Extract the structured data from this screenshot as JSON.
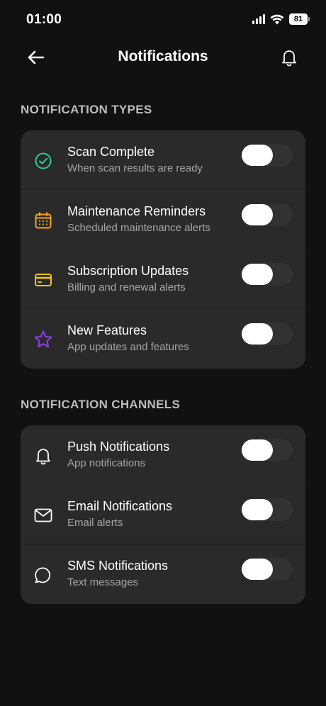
{
  "status_bar": {
    "time": "01:00",
    "battery": "81"
  },
  "header": {
    "title": "Notifications",
    "back_icon": "arrow-left-icon",
    "right_icon": "bell-icon"
  },
  "sections": [
    {
      "title": "NOTIFICATION TYPES",
      "items": [
        {
          "title": "Scan Complete",
          "subtitle": "When scan results are ready",
          "icon": "check-circle-icon",
          "icon_color": "#2ecc8f",
          "enabled": false
        },
        {
          "title": "Maintenance Reminders",
          "subtitle": "Scheduled maintenance alerts",
          "icon": "calendar-icon",
          "icon_color": "#f5a524",
          "enabled": false
        },
        {
          "title": "Subscription Updates",
          "subtitle": "Billing and renewal alerts",
          "icon": "credit-card-icon",
          "icon_color": "#f5c518",
          "enabled": false
        },
        {
          "title": "New Features",
          "subtitle": "App updates and features",
          "icon": "star-icon",
          "icon_color": "#8b3ff0",
          "enabled": false
        }
      ]
    },
    {
      "title": "NOTIFICATION CHANNELS",
      "items": [
        {
          "title": "Push Notifications",
          "subtitle": "App notifications",
          "icon": "bell-icon",
          "icon_color": "#ffffff",
          "enabled": false
        },
        {
          "title": "Email Notifications",
          "subtitle": "Email alerts",
          "icon": "mail-icon",
          "icon_color": "#ffffff",
          "enabled": false
        },
        {
          "title": "SMS Notifications",
          "subtitle": "Text messages",
          "icon": "message-circle-icon",
          "icon_color": "#ffffff",
          "enabled": false
        }
      ]
    }
  ]
}
